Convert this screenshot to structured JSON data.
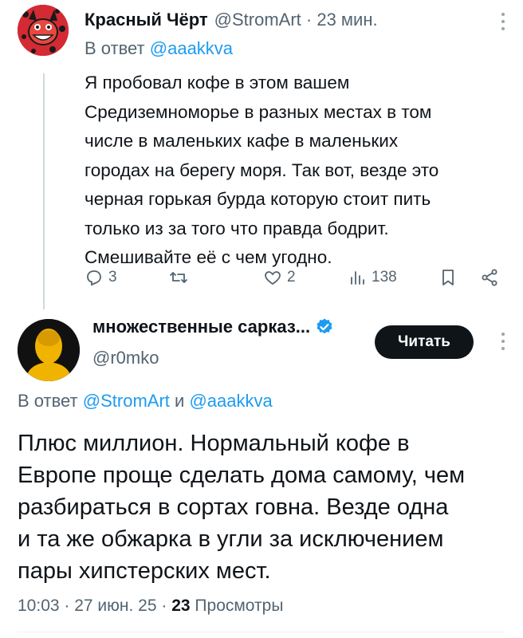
{
  "reply_tweet": {
    "author_name": "Красный Чёрт",
    "handle_time": "@StromArt · 23 мин.",
    "reply_prefix": "В ответ",
    "reply_to": "@aaakkva",
    "text_lines": [
      "Я пробовал кофе в этом вашем",
      "Средиземноморье в разных местах в том",
      "числе в маленьких кафе в маленьких",
      "городах на берегу моря. Так вот, везде это",
      "черная горькая бурда которую стоит пить",
      "только из за того что правда бодрит.",
      "Смешивайте её с чем угодно."
    ],
    "actions": {
      "replies": "3",
      "retweets": "",
      "likes": "2",
      "views": "138"
    }
  },
  "main_tweet": {
    "author_name": "множественные сарказ...",
    "handle": "@r0mko",
    "follow_label": "Читать",
    "reply_prefix": "В ответ",
    "reply_to_1": "@StromArt",
    "reply_and": "и",
    "reply_to_2": "@aaakkva",
    "text_lines": [
      "Плюс миллион. Нормальный кофе в",
      "Европе проще сделать дома самому, чем",
      "разбираться в сортах говна. Везде одна",
      "и та же обжарка в угли за исключением",
      "пары хипстерских мест."
    ],
    "time": "10:03",
    "date": "27 июн. 25",
    "views_count": "23",
    "views_label": "Просмотры"
  },
  "colors": {
    "accent": "#1d9bf0",
    "secondary_text": "#536471",
    "primary_text": "#0f1419",
    "follow_bg": "#0f1419"
  }
}
